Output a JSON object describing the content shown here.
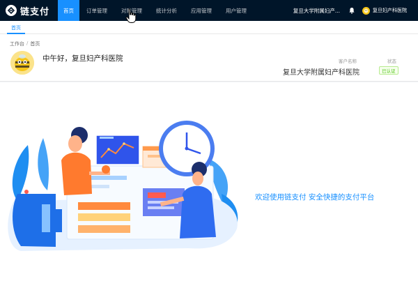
{
  "app": {
    "logo_text": "链支付"
  },
  "nav": {
    "items": [
      {
        "label": "首页",
        "active": true
      },
      {
        "label": "订单管理"
      },
      {
        "label": "对账管理"
      },
      {
        "label": "统计分析"
      },
      {
        "label": "应用管理"
      },
      {
        "label": "用户管理"
      }
    ],
    "org_name": "复旦大学附属妇产...",
    "user_name": "复旦妇产科医院"
  },
  "tabs": [
    {
      "label": "首页"
    }
  ],
  "breadcrumb": {
    "root": "工作台",
    "sep": "/",
    "current": "首页"
  },
  "header": {
    "greeting": "中午好，复旦妇产科医院",
    "customer_label": "客户名称",
    "customer_value": "复旦大学附属妇产科医院",
    "status_label": "状态",
    "status_value": "已认证"
  },
  "main": {
    "welcome_text": "欢迎使用链支付 安全快捷的支付平台"
  },
  "colors": {
    "nav_bg": "#001529",
    "accent": "#1890ff",
    "success": "#52c41a"
  }
}
